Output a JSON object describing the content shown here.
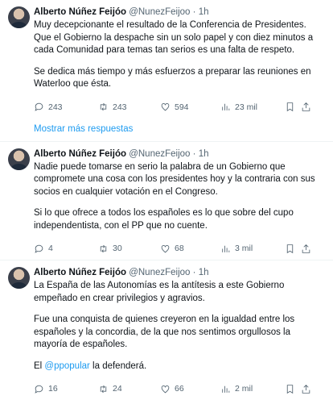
{
  "tweets": [
    {
      "name": "Alberto Núñez Feijóo",
      "handle": "@NunezFeijoo",
      "dot": "·",
      "time": "1h",
      "paragraphs": [
        "Muy decepcionante el resultado de la Conferencia de Presidentes. Que el Gobierno la despache sin un solo papel y con diez minutos a cada Comunidad para temas tan serios es una falta de respeto.",
        "Se dedica más tiempo y más esfuerzos a preparar las reuniones en Waterloo que ésta."
      ],
      "replies": "243",
      "retweets": "243",
      "likes": "594",
      "views": "23 mil"
    },
    {
      "name": "Alberto Núñez Feijóo",
      "handle": "@NunezFeijoo",
      "dot": "·",
      "time": "1h",
      "paragraphs": [
        "Nadie puede tomarse en serio la palabra de un Gobierno que compromete una cosa con los presidentes hoy y la contraria con sus socios en cualquier votación en el Congreso.",
        "Si lo que ofrece a todos los españoles es lo que sobre del cupo independentista, con el PP que no cuente."
      ],
      "replies": "4",
      "retweets": "30",
      "likes": "68",
      "views": "3 mil"
    },
    {
      "name": "Alberto Núñez Feijóo",
      "handle": "@NunezFeijoo",
      "dot": "·",
      "time": "1h",
      "paragraphs": [
        "La España de las Autonomías es la antítesis a este Gobierno empeñado en crear privilegios y agravios.",
        "Fue una conquista de quienes creyeron en la igualdad entre los españoles y la concordia, de la que nos sentimos orgullosos la mayoría de españoles."
      ],
      "last_prefix": "El ",
      "last_mention": "@ppopular",
      "last_suffix": " la defenderá.",
      "replies": "16",
      "retweets": "24",
      "likes": "66",
      "views": "2 mil"
    }
  ],
  "show_more": "Mostrar más respuestas",
  "icons": [
    "reply-icon",
    "retweet-icon",
    "like-icon",
    "views-icon",
    "bookmark-icon",
    "share-icon"
  ],
  "colors": {
    "link": "#1d9bf0",
    "muted": "#536471",
    "text": "#0f1419"
  }
}
